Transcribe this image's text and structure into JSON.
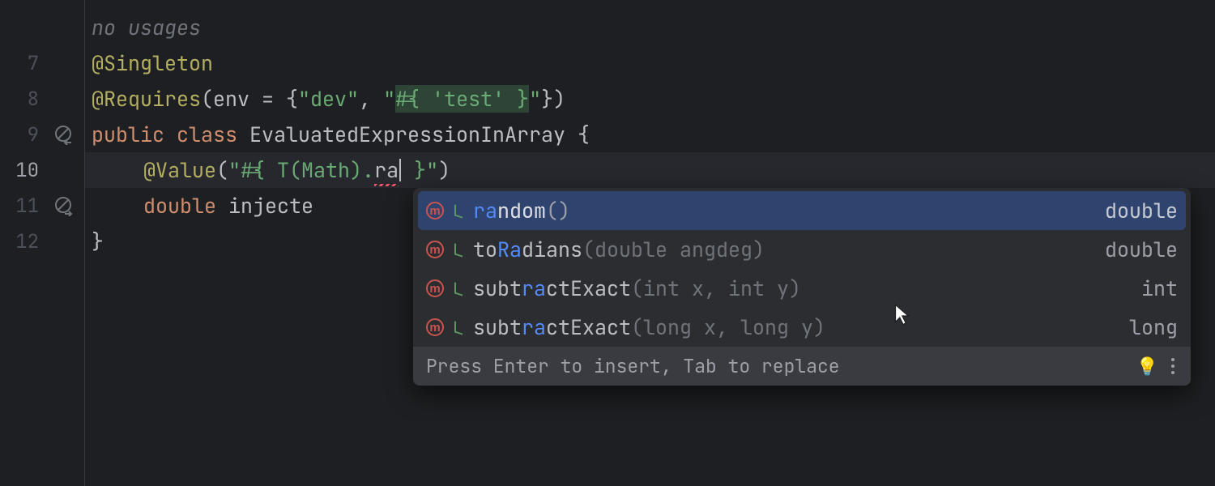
{
  "gutter": {
    "lines": [
      {
        "num": "",
        "icon": null
      },
      {
        "num": "7",
        "icon": null
      },
      {
        "num": "8",
        "icon": null
      },
      {
        "num": "9",
        "icon": "no-entry-left"
      },
      {
        "num": "10",
        "icon": null,
        "current": true
      },
      {
        "num": "11",
        "icon": "no-entry-right"
      },
      {
        "num": "12",
        "icon": null
      }
    ]
  },
  "code": {
    "usage_hint": "no usages",
    "line7": {
      "annotation": "@Singleton"
    },
    "line8": {
      "annotation": "@Requires",
      "open": "(env = {",
      "str1": "\"dev\"",
      "comma": ", ",
      "quote_open": "\"",
      "expr": "#{ 'test' }",
      "quote_close": "\"",
      "close": "})"
    },
    "line9": {
      "public": "public ",
      "class": "class ",
      "name": "EvaluatedExpressionInArray",
      "brace": " {"
    },
    "line10": {
      "annotation": "@Value",
      "open": "(",
      "quote_open": "\"",
      "before": "#{ T(Math).",
      "typed": "ra",
      "after": " }",
      "quote_close": "\"",
      "close": ")"
    },
    "line11": {
      "type": "double ",
      "ident": "injecte"
    },
    "line12": {
      "brace": "}"
    }
  },
  "completion": {
    "items": [
      {
        "pre": "",
        "hl": "ra",
        "post": "ndom",
        "params": "()",
        "ret": "double",
        "selected": true
      },
      {
        "pre": "to",
        "hl": "Ra",
        "post": "dians",
        "params": "(double angdeg)",
        "ret": "double",
        "selected": false
      },
      {
        "pre": "subt",
        "hl": "ra",
        "post": "ctExact",
        "params": "(int x, int y)",
        "ret": "int",
        "selected": false
      },
      {
        "pre": "subt",
        "hl": "ra",
        "post": "ctExact",
        "params": "(long x, long y)",
        "ret": "long",
        "selected": false
      }
    ],
    "footer_hint": "Press Enter to insert, Tab to replace",
    "m_glyph": "m"
  }
}
